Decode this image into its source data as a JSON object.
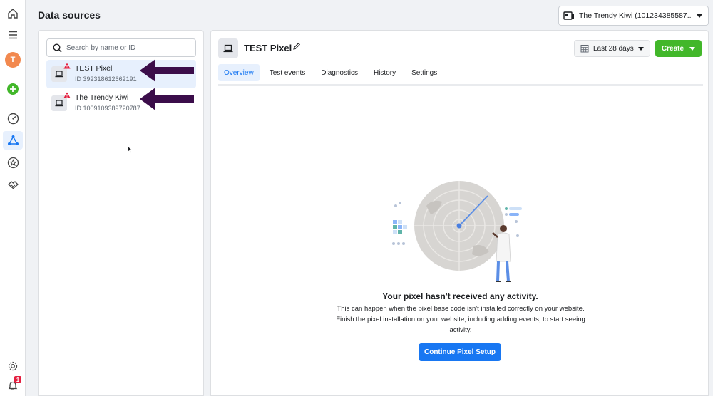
{
  "header": {
    "title": "Data sources",
    "account_selector": "The Trendy Kiwi (101234385587..."
  },
  "rail": {
    "avatar_initial": "T",
    "notification_count": "1"
  },
  "left_panel": {
    "search_placeholder": "Search by name or ID",
    "sources": [
      {
        "name": "TEST Pixel",
        "id": "ID 392318612662191",
        "selected": true
      },
      {
        "name": "The Trendy Kiwi",
        "id": "ID 1009109389720787",
        "selected": false
      }
    ]
  },
  "pixel_panel": {
    "title": "TEST Pixel",
    "date_range": "Last 28 days",
    "create_label": "Create",
    "tabs": [
      {
        "label": "Overview",
        "active": true
      },
      {
        "label": "Test events",
        "active": false
      },
      {
        "label": "Diagnostics",
        "active": false
      },
      {
        "label": "History",
        "active": false
      },
      {
        "label": "Settings",
        "active": false
      }
    ],
    "empty_state": {
      "title": "Your pixel hasn't received any activity.",
      "description": "This can happen when the pixel base code isn't installed correctly on your website. Finish the pixel installation on your website, including adding events, to start seeing activity.",
      "button_label": "Continue Pixel Setup"
    }
  },
  "colors": {
    "primary_blue": "#1877f2",
    "create_green": "#42b72a",
    "selected_bg": "#e7f0fd",
    "warning_red": "#e41e3f",
    "arrow_purple": "#3b0d4a"
  },
  "icons": [
    "home-icon",
    "menu-icon",
    "add-icon",
    "dashboard-icon",
    "data-sources-icon",
    "star-icon",
    "partners-icon",
    "settings-icon",
    "bell-icon",
    "search-icon",
    "computer-icon",
    "warning-icon",
    "edit-icon",
    "calendar-icon"
  ]
}
